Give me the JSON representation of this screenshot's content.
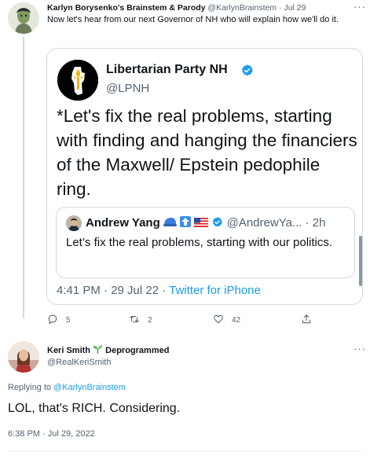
{
  "tweet": {
    "author_name": "Karlyn Borysenko's Brainstem & Parody",
    "author_handle": "@KarlynBrainstem",
    "date": "Jul 29",
    "text": "Now let's hear from our next Governor of NH who will explain how we'll do it.",
    "more_label": "···",
    "actions": {
      "replies": "5",
      "retweets": "2",
      "likes": "42"
    }
  },
  "quoted": {
    "author_name": "Libertarian Party NH",
    "author_handle": "@LPNH",
    "text": "*Let's fix the real problems, starting with finding and hanging the financiers of the Maxwell/ Epstein pedophile ring.",
    "time": "4:41 PM · 29 Jul 22 · ",
    "source": "Twitter for iPhone",
    "inner": {
      "author_name": "Andrew Yang",
      "author_meta": "@AndrewYa... · 2h",
      "text": "Let’s fix the real problems, starting with our politics."
    }
  },
  "reply": {
    "author_name": "Keri Smith",
    "author_name_suffix": "Deprogrammed",
    "author_handle": "@RealKeriSmith",
    "replying_prefix": "Replying to ",
    "replying_to": "@KarlynBrainstem",
    "text": "LOL, that's RICH. Considering.",
    "timestamp": "6:38 PM · Jul 29, 2022",
    "more_label": "···"
  },
  "colors": {
    "accent": "#1d9bf0",
    "muted": "#536471",
    "text": "#0f1419",
    "border": "#cfd9de"
  }
}
